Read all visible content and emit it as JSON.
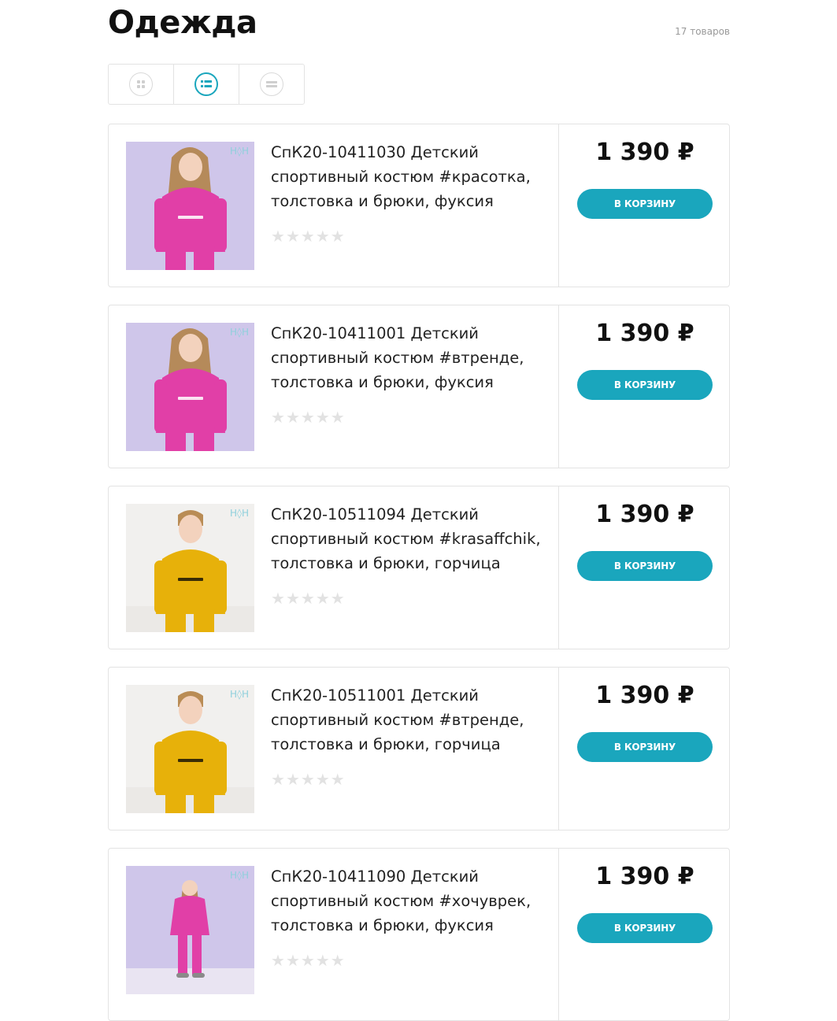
{
  "page": {
    "title": "Одежда",
    "count": "17 товаров"
  },
  "view_modes": [
    "grid",
    "list",
    "compact"
  ],
  "active_view": "list",
  "colors": {
    "accent": "#1aa6bd",
    "star_empty": "#e2e2e2"
  },
  "products": [
    {
      "name": "СпК20-10411030 Детский спортивный костюм #красотка, толстовка и брюки, фуксия",
      "price": "1 390 ₽",
      "cart_label": "В КОРЗИНУ",
      "rating": 0,
      "image": "girl-pink-hoodie",
      "color": "#e13fa7"
    },
    {
      "name": "СпК20-10411001 Детский спортивный костюм #втренде, толстовка и брюки, фуксия",
      "price": "1 390 ₽",
      "cart_label": "В КОРЗИНУ",
      "rating": 0,
      "image": "girl-pink-hoodie",
      "color": "#e13fa7"
    },
    {
      "name": "СпК20-10511094 Детский спортивный костюм #krasaffchik, толстовка и брюки, горчица",
      "price": "1 390 ₽",
      "cart_label": "В КОРЗИНУ",
      "rating": 0,
      "image": "boy-mustard-hoodie",
      "color": "#e7b10a"
    },
    {
      "name": "СпК20-10511001 Детский спортивный костюм #втренде, толстовка и брюки, горчица",
      "price": "1 390 ₽",
      "cart_label": "В КОРЗИНУ",
      "rating": 0,
      "image": "boy-mustard-hoodie",
      "color": "#e7b10a"
    },
    {
      "name": "СпК20-10411090 Детский спортивный костюм #хочуврек, толстовка и брюки, фуксия",
      "price": "1 390 ₽",
      "cart_label": "В КОРЗИНУ",
      "rating": 0,
      "image": "girl-pink-tracksuit",
      "color": "#e13fa7"
    }
  ]
}
